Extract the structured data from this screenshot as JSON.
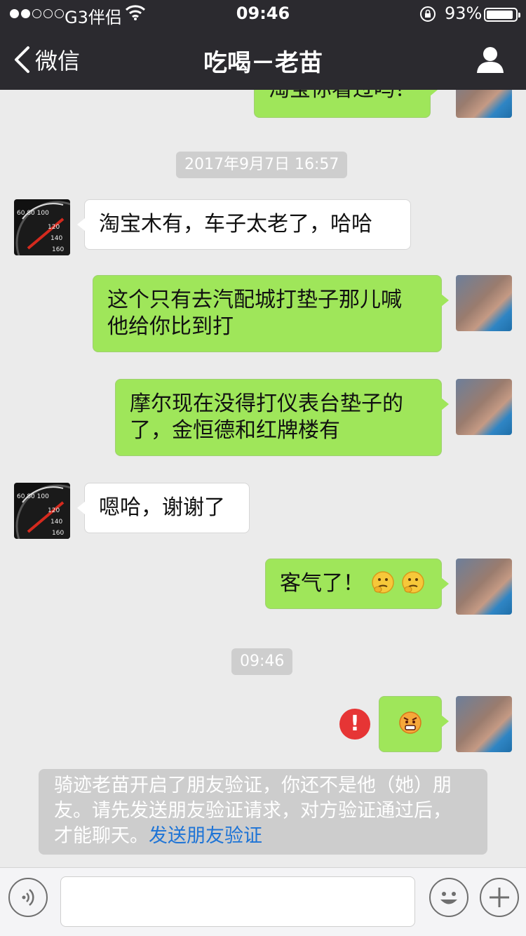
{
  "status": {
    "carrier": "G3伴侣",
    "time": "09:46",
    "battery": "93%"
  },
  "nav": {
    "back_label": "微信",
    "title": "吃喝－老苗"
  },
  "messages": {
    "partial_text": "淘宝你看过吗？",
    "timestamp1": "2017年9月7日 16:57",
    "m1": "淘宝木有，车子太老了，哈哈",
    "m2_line1": "这个只有去汽配城打垫子那儿喊",
    "m2_line2": "他给你比到打",
    "m3_line1": "摩尔现在没得打仪表台垫子的",
    "m3_line2": "了，金恒德和红牌楼有",
    "m4": "嗯哈，谢谢了",
    "m5": "客气了！",
    "timestamp2": "09:46",
    "error_mark": "!"
  },
  "system_notice": {
    "line1": "骑迹老苗开启了朋友验证，你还不是他（她）朋",
    "line2": "友。请先发送朋友验证请求，对方验证通过后，",
    "line3": "才能聊天。",
    "link": "发送朋友验证"
  }
}
